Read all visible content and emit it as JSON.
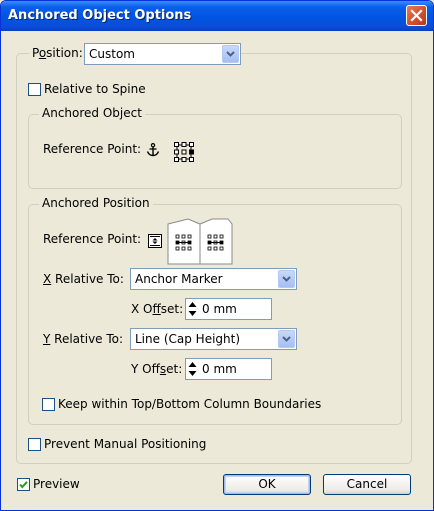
{
  "dialog": {
    "title": "Anchored Object Options",
    "position": {
      "label_pre": "P",
      "label_u": "o",
      "label_post": "sition:",
      "value": "Custom"
    },
    "relative_to_spine": {
      "label": "Relative to Spine",
      "checked": false
    },
    "anchored_object": {
      "legend": "Anchored Object",
      "reference_point_label": "Reference Point:",
      "anchor_icon": "anchor-icon",
      "proxy_icon": "reference-point-proxy-icon"
    },
    "anchored_position": {
      "legend": "Anchored Position",
      "reference_point_label": "Reference Point:",
      "x_relative_to": {
        "label_u": "X",
        "label_rest": " Relative To:",
        "value": "Anchor Marker"
      },
      "x_offset": {
        "label_pre": "X O",
        "label_u": "f",
        "label_post": "fset:",
        "value": "0 mm"
      },
      "y_relative_to": {
        "label_u": "Y",
        "label_rest": " Relative To:",
        "value": "Line (Cap Height)"
      },
      "y_offset": {
        "label_pre": "Y Off",
        "label_u": "s",
        "label_post": "et:",
        "value": "0 mm"
      },
      "keep_within": {
        "label": "Keep within Top/Bottom Column Boundaries",
        "checked": false
      }
    },
    "prevent_manual_positioning": {
      "label": "Prevent Manual Positioning",
      "checked": false
    },
    "preview": {
      "label": "Preview",
      "checked": true
    },
    "ok_label": "OK",
    "cancel_label": "Cancel"
  }
}
